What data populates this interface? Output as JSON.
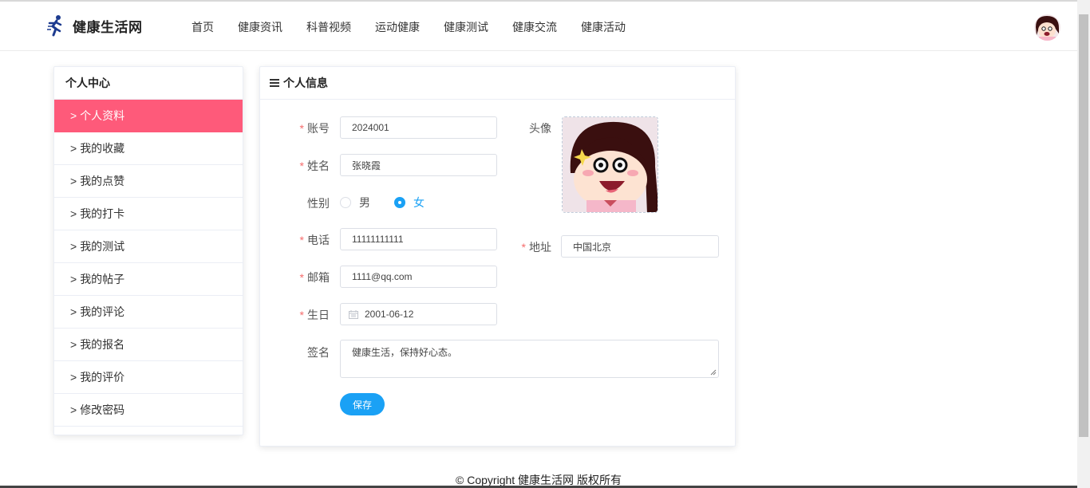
{
  "brand": {
    "name": "健康生活网"
  },
  "nav": {
    "items": [
      "首页",
      "健康资讯",
      "科普视频",
      "运动健康",
      "健康测试",
      "健康交流",
      "健康活动"
    ]
  },
  "sidebar": {
    "title": "个人中心",
    "chevron": ">",
    "items": [
      "个人资料",
      "我的收藏",
      "我的点赞",
      "我的打卡",
      "我的测试",
      "我的帖子",
      "我的评论",
      "我的报名",
      "我的评价",
      "修改密码"
    ],
    "active_index": 0
  },
  "card": {
    "title": "个人信息"
  },
  "form": {
    "required_mark": "*",
    "account_label": "账号",
    "account_value": "2024001",
    "name_label": "姓名",
    "name_value": "张晓霞",
    "gender_label": "性别",
    "gender_options": [
      "男",
      "女"
    ],
    "gender_selected": "女",
    "phone_label": "电话",
    "phone_value": "11111111111",
    "email_label": "邮箱",
    "email_value": "1111@qq.com",
    "birthday_label": "生日",
    "birthday_value": "2001-06-12",
    "avatar_label": "头像",
    "address_label": "地址",
    "address_value": "中国北京",
    "signature_label": "签名",
    "signature_value": "健康生活，保持好心态。",
    "save_label": "保存"
  },
  "footer": {
    "text": "© Copyright 健康生活网 版权所有"
  },
  "colors": {
    "accent": "#1aa1f5",
    "active_menu": "#fe5a7a",
    "required": "#f56c6c"
  },
  "icons": {
    "logo": "running-person-icon",
    "list": "list-icon",
    "calendar": "calendar-icon"
  }
}
